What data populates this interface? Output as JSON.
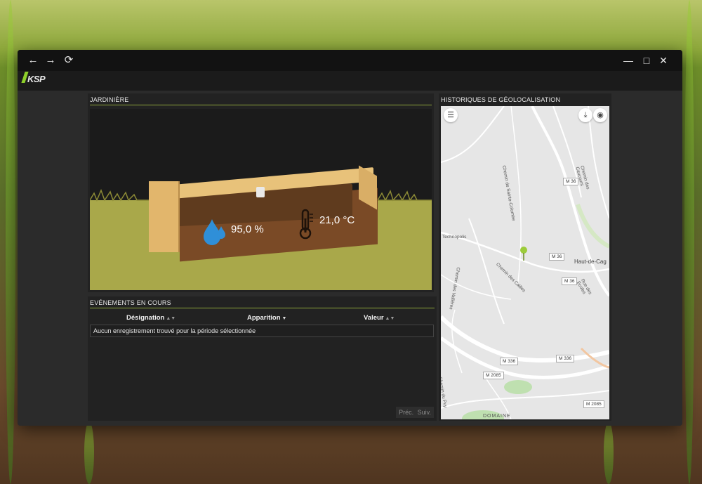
{
  "toolbar": {
    "back_icon": "arrow-left-icon",
    "forward_icon": "arrow-right-icon",
    "refresh_icon": "refresh-icon",
    "back_glyph": "←",
    "forward_glyph": "→",
    "refresh_glyph": "⟳",
    "minimize_glyph": "—",
    "maximize_glyph": "□",
    "close_glyph": "✕"
  },
  "brand": {
    "logo_text": "KSP"
  },
  "jardiniere": {
    "title": "JARDINIÈRE",
    "humidity": "95,0 %",
    "temperature": "21,0 °C"
  },
  "events": {
    "title": "EVÉNEMENTS EN COURS",
    "columns": [
      "Désignation",
      "Apparition",
      "Valeur"
    ],
    "empty_message": "Aucun enregistrement trouvé pour la période sélectionnée",
    "prev_label": "Préc.",
    "next_label": "Suiv."
  },
  "geoloc": {
    "title": "HISTORIQUES DE GÉOLOCALISATION",
    "labels": {
      "technopolis": "Technopolis",
      "haut_de_cagnes": "Haut-de-Cag",
      "chemin_sainte_colombe": "Chemin de Sainte-Colombe",
      "chemin_des_cailles": "Chemin des Cailles",
      "chemin_des_vallieres": "Chemin des Vallières",
      "chemin_des_salinieres": "Chemin des Salinières",
      "chemin_des_caucours": "Chemin des Caucours",
      "rue_des_ecoles": "Rue des Écoles",
      "chemin_du_puy": "Chemin du Puy",
      "domaine": "DOMAINE"
    },
    "roads": [
      "M 36",
      "M 36",
      "M 36",
      "M 336",
      "M 336",
      "M 2085",
      "M 2085"
    ]
  },
  "colors": {
    "accent": "#8fa53a",
    "pin": "#9ccc3a",
    "water": "#2f8fd8"
  }
}
